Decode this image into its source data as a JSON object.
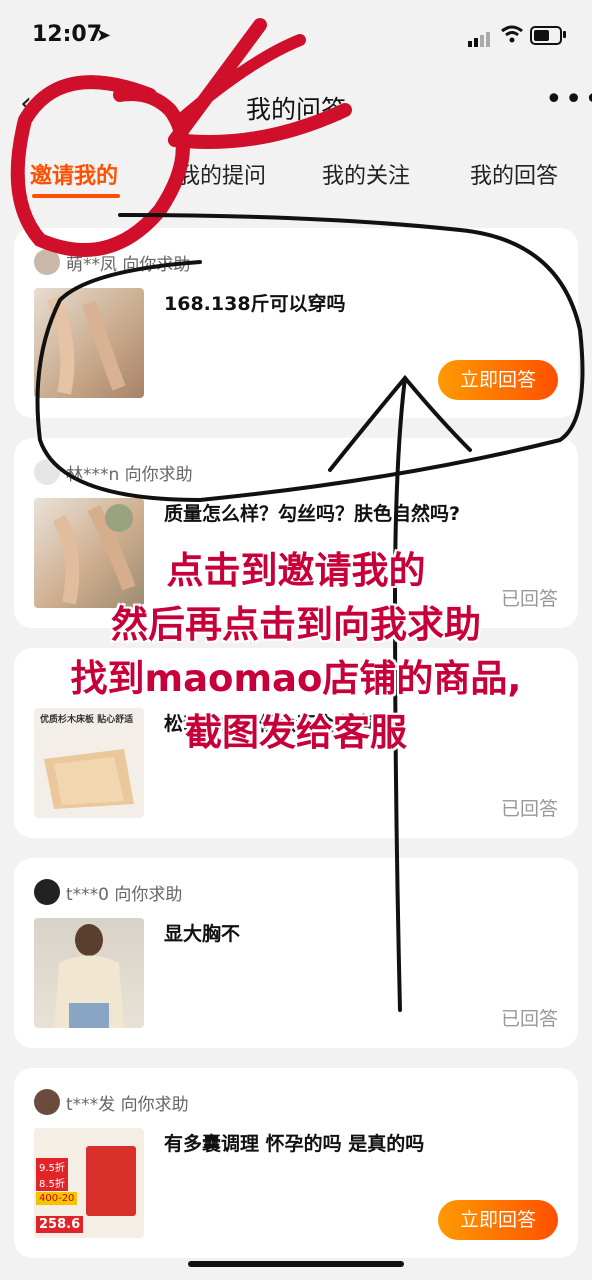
{
  "status_bar": {
    "time": "12:07",
    "location_icon": "location-arrow-icon"
  },
  "nav": {
    "title": "我的问答",
    "more": "•••"
  },
  "tabs": [
    {
      "label": "邀请我的",
      "active": true
    },
    {
      "label": "我的提问",
      "active": false
    },
    {
      "label": "我的关注",
      "active": false
    },
    {
      "label": "我的回答",
      "active": false
    }
  ],
  "cards": [
    {
      "asker": "萌**凤 向你求助",
      "question": "168.138斤可以穿吗",
      "action": "立即回答"
    },
    {
      "asker": "林***n 向你求助",
      "question": "质量怎么样？勾丝吗？肤色自然吗?",
      "status": "已回答"
    },
    {
      "thumb_text_1": "优质杉木床板 贴心舒适",
      "question": "松动去的时候会不会有声响?",
      "status": "已回答"
    },
    {
      "asker": "t***0 向你求助",
      "question": "显大胸不",
      "status": "已回答"
    },
    {
      "asker": "t***发 向你求助",
      "question": "有多囊调理 怀孕的吗 是真的吗",
      "action": "立即回答",
      "thumb_badges": [
        "9.5折",
        "8.5折",
        "400-20",
        "258.6"
      ]
    }
  ],
  "overlay": {
    "line1": "点击到邀请我的",
    "line2": "然后再点击到向我求助",
    "line3": "找到maomao店铺的商品,",
    "line4": "截图发给客服"
  },
  "colors": {
    "accent": "#ff5000",
    "overlay_text": "#c8003a",
    "marker_red": "#d0102a"
  }
}
